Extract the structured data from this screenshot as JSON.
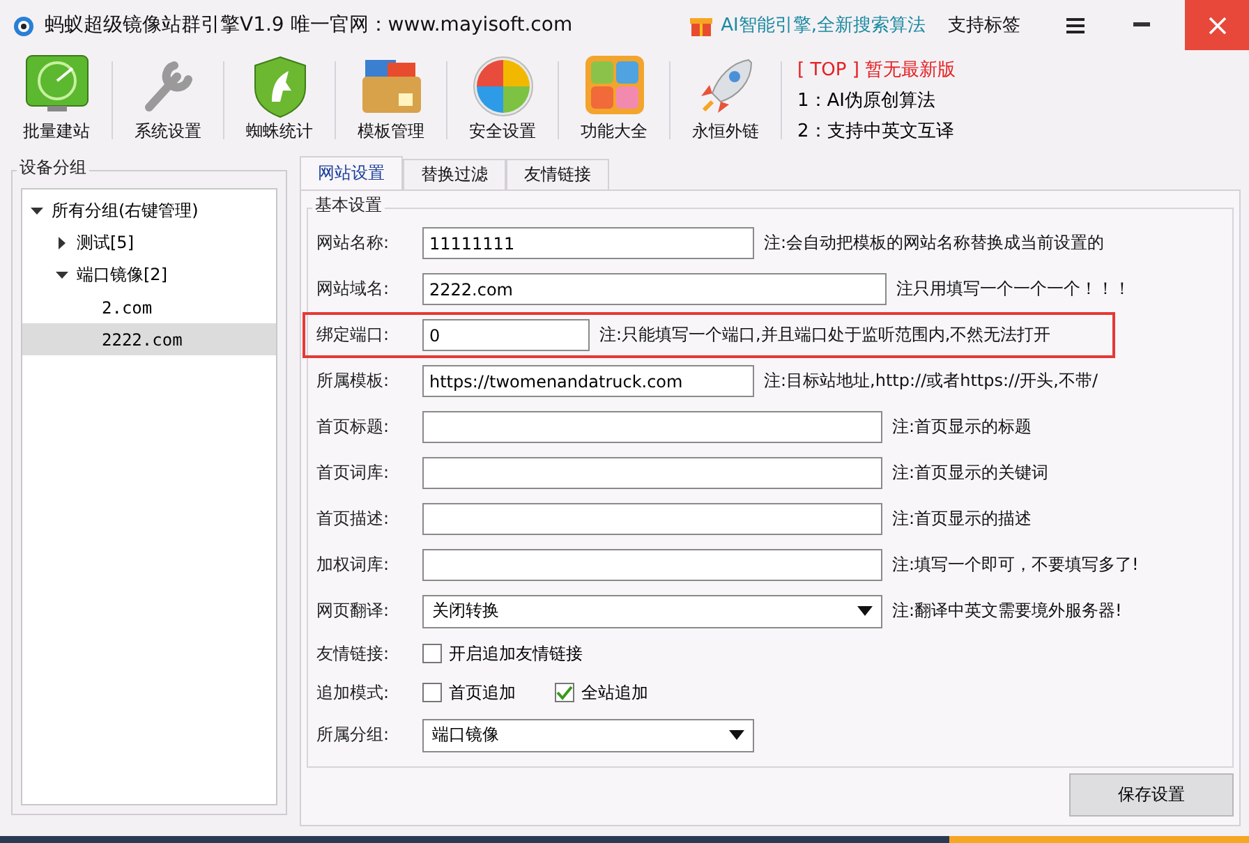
{
  "window": {
    "title": "蚂蚁超级镜像站群引擎V1.9  唯一官网：www.mayisoft.com",
    "promo": "AI智能引擎,全新搜索算法",
    "tags_link": "支持标签"
  },
  "toolbar": [
    {
      "label": "批量建站"
    },
    {
      "label": "系统设置"
    },
    {
      "label": "蜘蛛统计"
    },
    {
      "label": "模板管理"
    },
    {
      "label": "安全设置"
    },
    {
      "label": "功能大全"
    },
    {
      "label": "永恒外链"
    }
  ],
  "news": {
    "headline": "[ TOP ] 暂无最新版",
    "lines": [
      "1：AI伪原创算法",
      "2：支持中英文互译"
    ]
  },
  "sidebar": {
    "title": "设备分组",
    "tree": [
      {
        "label": "所有分组(右键管理)",
        "expanded": true,
        "selected": false,
        "children": [
          {
            "label": "测试[5]",
            "expanded": false,
            "selected": false
          },
          {
            "label": "端口镜像[2]",
            "expanded": true,
            "selected": false,
            "children": [
              {
                "label": "2.com",
                "selected": false
              },
              {
                "label": "2222.com",
                "selected": true
              }
            ]
          }
        ]
      }
    ]
  },
  "tabs": [
    {
      "label": "网站设置",
      "selected": true
    },
    {
      "label": "替换过滤",
      "selected": false
    },
    {
      "label": "友情链接",
      "selected": false
    }
  ],
  "section": "基本设置",
  "fields": [
    {
      "kind": "text",
      "label": "网站名称:",
      "value": "11111111",
      "note": "注:会自动把模板的网站名称替换成当前设置的",
      "highlighted": false
    },
    {
      "kind": "text",
      "label": "网站域名:",
      "value": "2222.com",
      "note": "注只用填写一个一个一个！！！",
      "highlighted": false
    },
    {
      "kind": "text",
      "label": "绑定端口:",
      "value": "0",
      "note": "注:只能填写一个端口,并且端口处于监听范围内,不然无法打开",
      "highlighted": true
    },
    {
      "kind": "text",
      "label": "所属模板:",
      "value": "https://twomenandatruck.com",
      "note": "注:目标站地址,http://或者https://开头,不带/",
      "highlighted": false
    },
    {
      "kind": "text",
      "label": "首页标题:",
      "note": "注:首页显示的标题",
      "highlighted": false
    },
    {
      "kind": "text",
      "label": "首页词库:",
      "note": "注:首页显示的关键词",
      "highlighted": false
    },
    {
      "kind": "text",
      "label": "首页描述:",
      "note": "注:首页显示的描述",
      "highlighted": false
    },
    {
      "kind": "text",
      "label": "加权词库:",
      "note": "注:填写一个即可，不要填写多了!",
      "highlighted": false
    },
    {
      "kind": "select",
      "label": "网页翻译:",
      "value": "关闭转换",
      "note": "注:翻译中英文需要境外服务器!",
      "highlighted": false
    },
    {
      "kind": "checks",
      "label": "友情链接:",
      "options": [
        {
          "label": "开启追加友情链接",
          "checked": false
        }
      ],
      "highlighted": false
    },
    {
      "kind": "checks",
      "label": "追加模式:",
      "options": [
        {
          "label": "首页追加",
          "checked": false
        },
        {
          "label": "全站追加",
          "checked": true
        }
      ],
      "highlighted": false
    },
    {
      "kind": "select",
      "label": "所属分组:",
      "value": "端口镜像",
      "highlighted": false
    }
  ],
  "save_button": "保存设置"
}
